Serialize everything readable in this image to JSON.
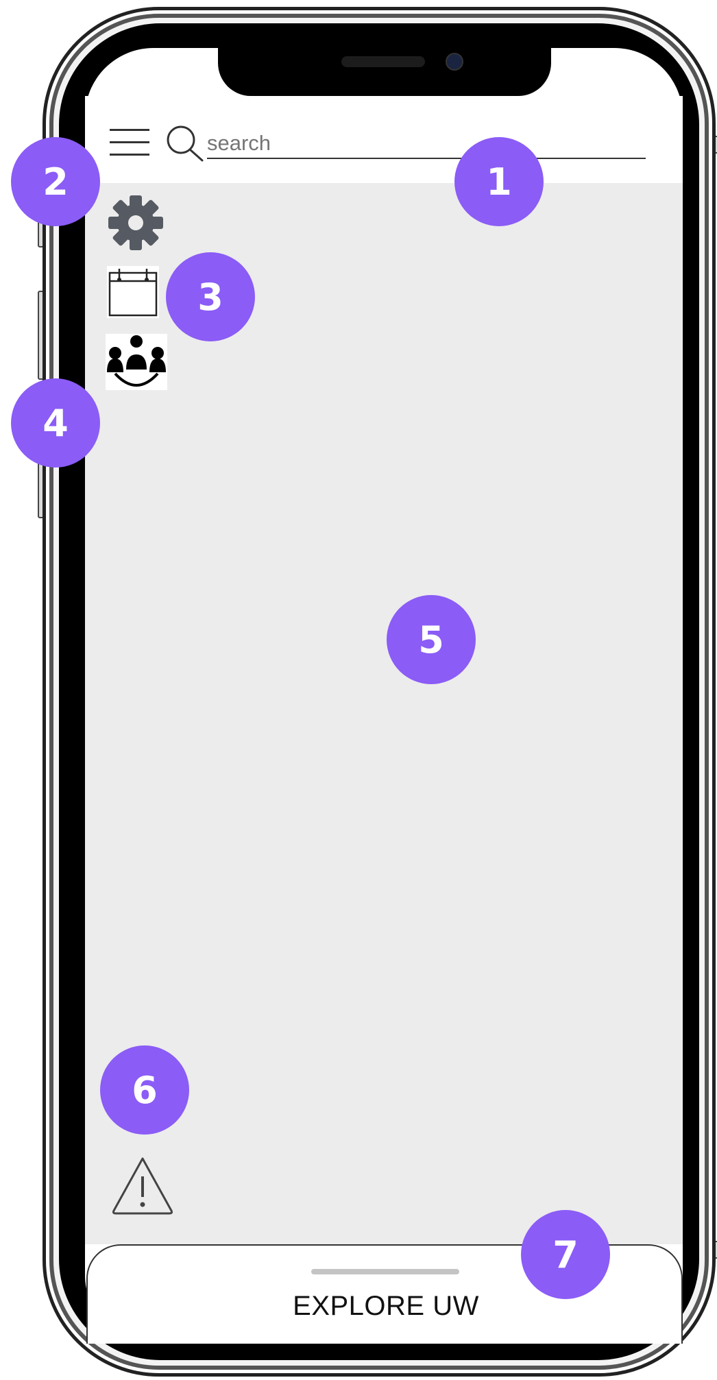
{
  "search": {
    "placeholder": "search"
  },
  "bottom_bar": {
    "label": "EXPLORE UW"
  },
  "icons": {
    "menu": "hamburger-menu-icon",
    "search": "magnifier-icon",
    "settings": "gear-icon",
    "calendar": "calendar-icon",
    "group": "people-group-icon",
    "warning": "warning-triangle-icon"
  },
  "markers": [
    "1",
    "2",
    "3",
    "4",
    "5",
    "6",
    "7"
  ],
  "colors": {
    "marker": "#8b5cf6",
    "content_background": "#ececec",
    "screen_background": "#ffffff"
  }
}
